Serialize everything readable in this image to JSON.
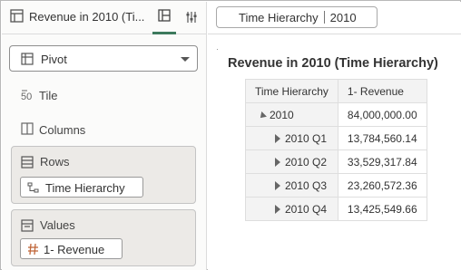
{
  "header": {
    "title": "Revenue in 2010 (Ti...",
    "icons": [
      "table-icon",
      "pivot-layout-icon",
      "properties-icon"
    ]
  },
  "visualization": {
    "type_label": "Pivot"
  },
  "grammar": {
    "tile_label": "Tile",
    "columns_label": "Columns",
    "rows": {
      "label": "Rows",
      "items": [
        {
          "label": "Time Hierarchy",
          "icon": "hierarchy-icon"
        }
      ]
    },
    "values": {
      "label": "Values",
      "items": [
        {
          "label": "1- Revenue",
          "icon": "hash-icon"
        }
      ]
    }
  },
  "filter": {
    "name": "Time Hierarchy",
    "value": "2010"
  },
  "pivot": {
    "title": "Revenue in 2010 (Time Hierarchy)",
    "headers": [
      "Time Hierarchy",
      "1- Revenue"
    ],
    "rows": [
      {
        "label": "2010",
        "value": "84,000,000.00",
        "level": 0,
        "expanded": true
      },
      {
        "label": "2010 Q1",
        "value": "13,784,560.14",
        "level": 1,
        "expanded": false
      },
      {
        "label": "2010 Q2",
        "value": "33,529,317.84",
        "level": 1,
        "expanded": false
      },
      {
        "label": "2010 Q3",
        "value": "23,260,572.36",
        "level": 1,
        "expanded": false
      },
      {
        "label": "2010 Q4",
        "value": "13,425,549.66",
        "level": 1,
        "expanded": false
      }
    ]
  },
  "colors": {
    "accent": "#3d7a5d",
    "panel_bg": "#fbfbfa",
    "section_bg": "#eceae7"
  }
}
